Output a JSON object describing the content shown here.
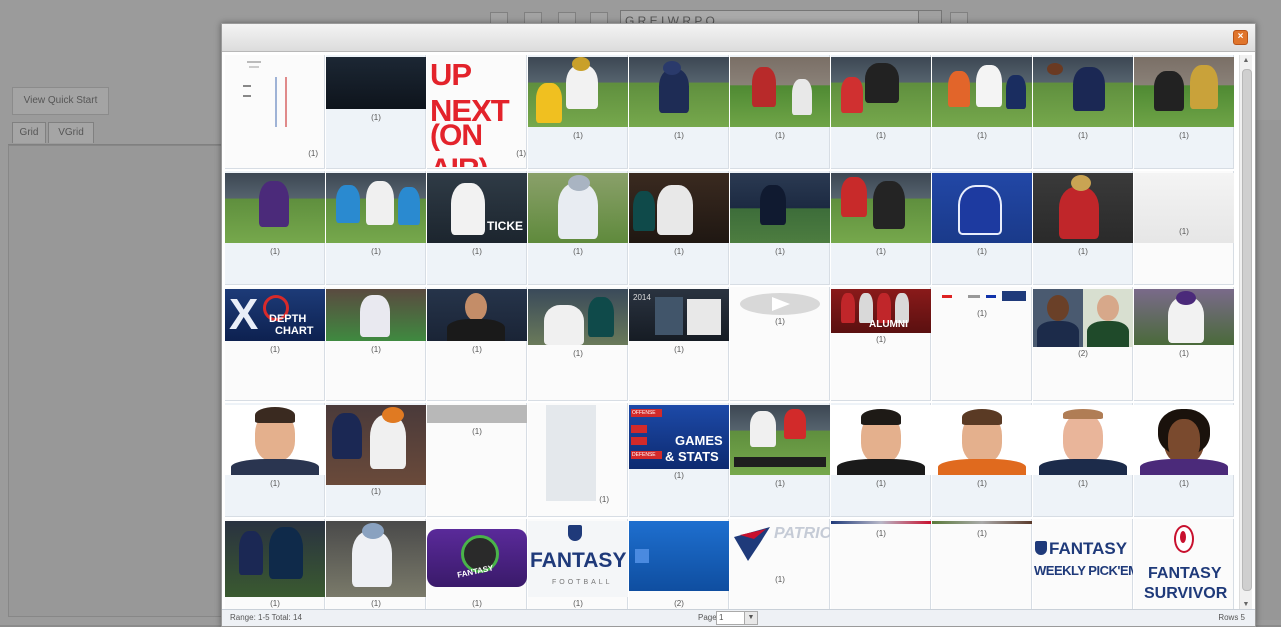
{
  "background": {
    "combo_text": "G R E I W R P O ...",
    "quick_start_label": "View Quick Start",
    "tabs": [
      {
        "label": "Grid"
      },
      {
        "label": "VGrid"
      }
    ]
  },
  "modal": {
    "close_icon": "close-icon",
    "thumbnails": {
      "r1": [
        "(1)",
        "(1)",
        "(1)",
        "(1)",
        "(1)",
        "(1)",
        "(1)",
        "(1)",
        "(1)",
        "(1)"
      ],
      "r2": [
        "(1)",
        "(1)",
        "(1)",
        "(1)",
        "(1)",
        "(1)",
        "(1)",
        "(1)",
        "(1)",
        "(1)"
      ],
      "r3": [
        "(1)",
        "(1)",
        "(1)",
        "(1)",
        "(1)",
        "(1)",
        "(1)",
        "(1)",
        "(2)",
        "(1)"
      ],
      "r4": [
        "(1)",
        "(1)",
        "(1)",
        "(1)",
        "(1)",
        "(1)",
        "(1)",
        "(1)",
        "(1)",
        "(1)"
      ],
      "r5": [
        "(1)",
        "(1)",
        "(1)",
        "(1)",
        "(2)",
        "(1)",
        "(1)",
        "(1)",
        "",
        ""
      ]
    },
    "art_text": {
      "up_next": "UP NEXT",
      "on_air": "(ON AIR)",
      "depth": "DEPTH",
      "chart": "CHART",
      "alumni": "ALUMNI",
      "games": "GAMES",
      "and_stats": "& STATS",
      "offense": "OFFENSE",
      "defense": "DEFENSE",
      "fantasy": "FANTASY",
      "football": "FOOTBALL",
      "fantasy2": "FANTASY",
      "weekly": "WEEKLY PICK'EM",
      "fantasy3": "FANTASY",
      "survivor": "SURVIVOR",
      "patriots": "PATRIOTS",
      "ticket": "TICKE",
      "year": "2014"
    },
    "footer": {
      "range": "Range: 1-5 Total: 14",
      "page_label": "Page",
      "page_value": "1",
      "rows": "Rows 5"
    }
  }
}
